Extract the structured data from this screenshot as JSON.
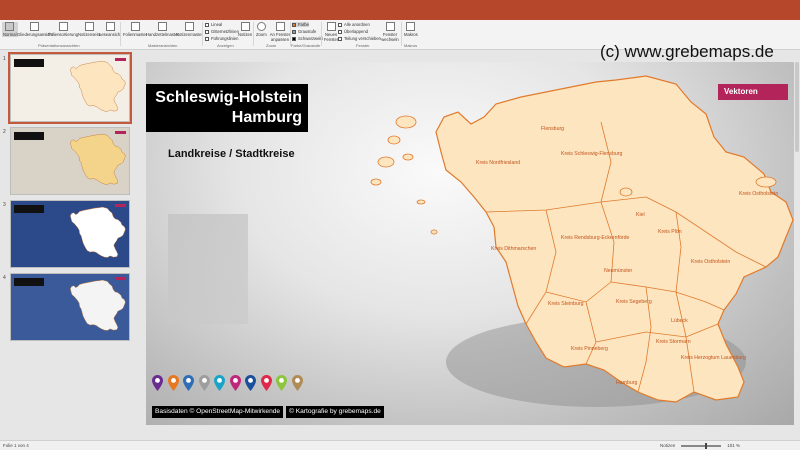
{
  "ribbon": {
    "view_buttons": [
      {
        "label": "Normal",
        "active": true
      },
      {
        "label": "Gliederungsansicht",
        "active": false
      },
      {
        "label": "Foliensortierung",
        "active": false
      },
      {
        "label": "Notizenseite",
        "active": false
      },
      {
        "label": "Leseansicht",
        "active": false
      }
    ],
    "master_buttons": [
      {
        "label": "Folienmaster"
      },
      {
        "label": "Handzettelmaster"
      },
      {
        "label": "Notizenmaster"
      }
    ],
    "show_checks": [
      "Lineal",
      "Gitternetzlinien",
      "Führungslinien"
    ],
    "notes_button": "Notizen",
    "zoom_buttons": [
      "Zoom",
      "An Fenster anpassen"
    ],
    "color_options": [
      "Farbe",
      "Graustufe",
      "Schwarzweiß"
    ],
    "window_buttons": [
      "Neues Fenster"
    ],
    "window_options": [
      "Alle anordnen",
      "Überlappend",
      "Teilung verschieben"
    ],
    "switch_button": "Fenster wechseln",
    "macro_button": "Makros",
    "groups": [
      "Präsentationsansichten",
      "Masteransichten",
      "Anzeigen",
      "Zoom",
      "Farbe/Graustufe",
      "Fenster",
      "Makros"
    ]
  },
  "copyright": "(c) www.grebemaps.de",
  "thumbnails": [
    {
      "number": "1",
      "bg": "#f4efe6",
      "map_fill": "#fde5c0",
      "selected": true
    },
    {
      "number": "2",
      "bg": "#d9d3c7",
      "map_fill": "#f3d48a",
      "selected": false
    },
    {
      "number": "3",
      "bg": "#2c4a8a",
      "map_fill": "#ffffff",
      "selected": false
    },
    {
      "number": "4",
      "bg": "#3a5a9a",
      "map_fill": "#f4f4f4",
      "selected": false
    }
  ],
  "slide": {
    "title_line1": "Schleswig-Holstein",
    "title_line2": "Hamburg",
    "subtitle": "Landkreise / Stadtkreise",
    "tag": "Vektoren",
    "map_fill": "#fde5c0",
    "map_stroke": "#e07a2c",
    "regions": [
      "Kreis Nordfriesland",
      "Flensburg",
      "Kreis Schleswig-Flensburg",
      "Kreis Ostholstein",
      "Kiel",
      "Kreis Plön",
      "Kreis Dithmarschen",
      "Kreis Rendsburg-Eckernförde",
      "Kreis Ostholstein",
      "Neumünster",
      "Kreis Steinburg",
      "Kreis Segeberg",
      "Lübeck",
      "Kreis Stormarn",
      "Kreis Pinneberg",
      "Kreis Herzogtum Lauenburg",
      "Hamburg"
    ],
    "pin_colors": [
      "#6a2c91",
      "#e87722",
      "#2f6db5",
      "#9e9e9e",
      "#1aa3c8",
      "#c0267a",
      "#1c4f9c",
      "#e0284a",
      "#8cc63f",
      "#b08d57"
    ],
    "credits": [
      "Basisdaten © OpenStreetMap-Mitwirkende",
      "© Kartografie by grebemaps.de"
    ]
  },
  "status": {
    "left": "Folie 1 von 4",
    "notes": "Notizen",
    "zoom": "101 %"
  }
}
